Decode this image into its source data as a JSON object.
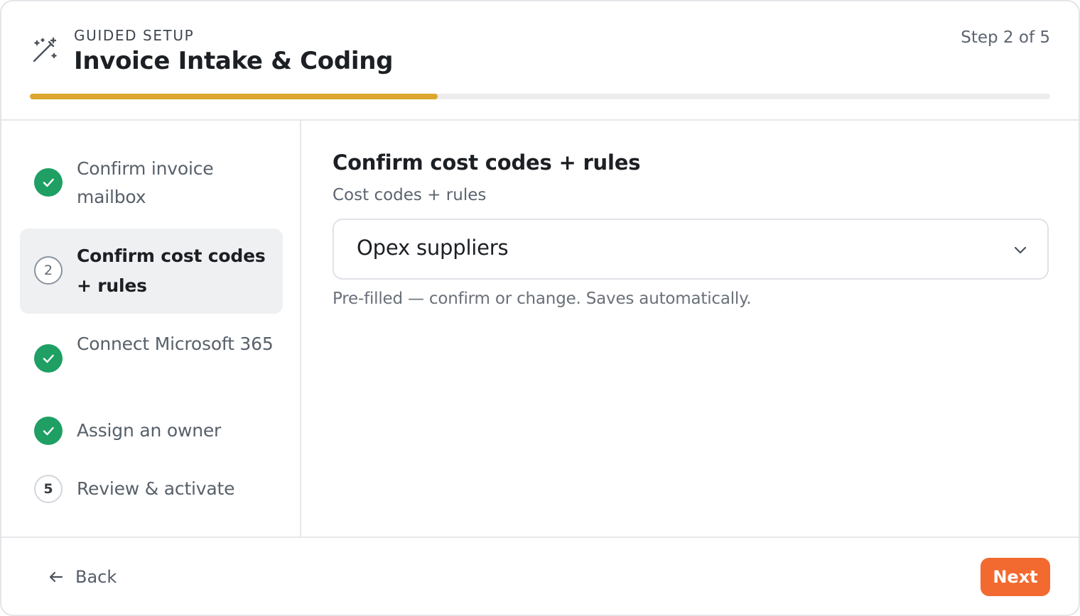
{
  "header": {
    "eyebrow": "GUIDED SETUP",
    "title": "Invoice Intake & Coding",
    "step_text": "Step 2 of 5",
    "progress": 0.4,
    "progress_color": "#dca72f"
  },
  "sidebar": {
    "steps": [
      {
        "label": "Confirm invoice mailbox",
        "status": "done",
        "icon": "check-icon"
      },
      {
        "number": "2",
        "label": "Confirm cost codes + rules",
        "status": "current"
      },
      {
        "label": "Connect Microsoft 365",
        "status": "done",
        "icon": "check-icon"
      },
      {
        "label": "Assign an owner",
        "status": "done",
        "icon": "check-icon"
      },
      {
        "number": "5",
        "label": "Review & activate",
        "status": "pending"
      }
    ]
  },
  "main": {
    "section_title": "Confirm cost codes + rules",
    "field_label": "Cost codes + rules",
    "select_value": "Opex suppliers",
    "hint": "Pre-filled — confirm or change. Saves automatically."
  },
  "footer": {
    "back_label": "Back",
    "next_label": "Next",
    "next_color": "#f26a2f"
  },
  "colors": {
    "done_green": "#1f9f64"
  }
}
